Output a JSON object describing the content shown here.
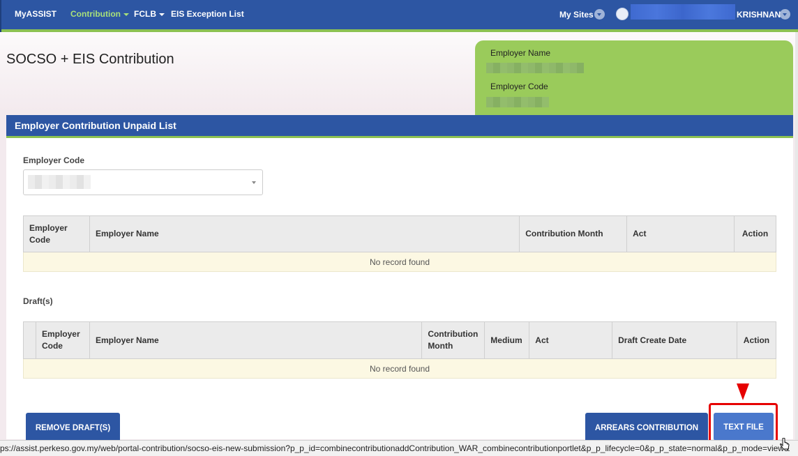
{
  "nav": {
    "brand": "MyASSIST",
    "contribution": "Contribution",
    "fclb": "FCLB",
    "eis_exception": "EIS Exception List",
    "my_sites": "My Sites",
    "username": "KRISHNAN"
  },
  "page": {
    "title": "SOCSO + EIS Contribution",
    "employer_name_label": "Employer Name",
    "employer_code_label": "Employer Code"
  },
  "unpaid": {
    "section_title": "Employer Contribution Unpaid List",
    "filter_label": "Employer Code",
    "columns": [
      "Employer Code",
      "Employer Name",
      "Contribution Month",
      "Act",
      "Action"
    ],
    "empty_text": "No record found"
  },
  "drafts": {
    "label": "Draft(s)",
    "columns": [
      "Employer Code",
      "Employer Name",
      "Contribution Month",
      "Medium",
      "Act",
      "Draft Create Date",
      "Action"
    ],
    "empty_text": "No record found"
  },
  "buttons": {
    "remove_drafts": "REMOVE DRAFT(S)",
    "arrears": "ARREARS CONTRIBUTION",
    "text_file": "TEXT FILE"
  },
  "status_url": "ps://assist.perkeso.gov.my/web/portal-contribution/socso-eis-new-submission?p_p_id=combinecontributionaddContribution_WAR_combinecontributionportlet&p_p_lifecycle=0&p_p_state=normal&p_p_mode=view&",
  "colors": {
    "nav_blue": "#2d56a3",
    "accent_green": "#8cc152",
    "card_green": "#9acb5b",
    "highlight_red": "#e60000"
  }
}
